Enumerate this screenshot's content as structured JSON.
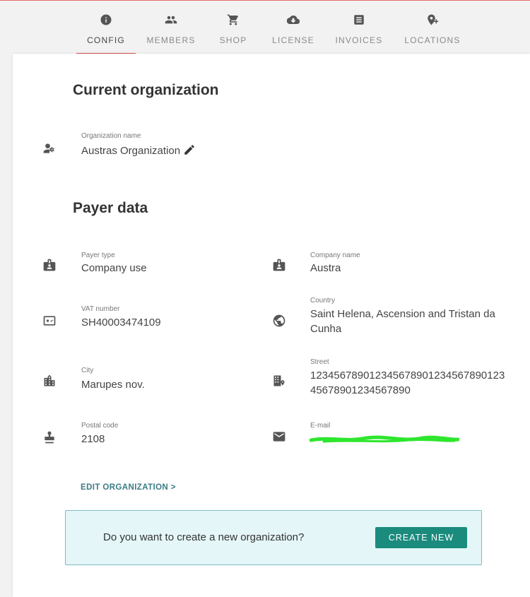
{
  "tabs": [
    {
      "label": "CONFIG",
      "icon": "info-icon"
    },
    {
      "label": "MEMBERS",
      "icon": "members-icon"
    },
    {
      "label": "SHOP",
      "icon": "cart-icon"
    },
    {
      "label": "LICENSE",
      "icon": "cloud-download-icon"
    },
    {
      "label": "INVOICES",
      "icon": "invoice-icon"
    },
    {
      "label": "LOCATIONS",
      "icon": "add-location-icon"
    }
  ],
  "active_tab": "CONFIG",
  "current_org": {
    "heading": "Current organization",
    "name_label": "Organization name",
    "name_value": "Austras Organization"
  },
  "payer": {
    "heading": "Payer data",
    "payer_type_label": "Payer type",
    "payer_type_value": "Company use",
    "company_name_label": "Company name",
    "company_name_value": "Austra",
    "vat_label": "VAT number",
    "vat_value": "SH40003474109",
    "country_label": "Country",
    "country_value_line1": "Saint Helena, Ascension and Tristan da",
    "country_value_line2": "Cunha",
    "city_label": "City",
    "city_value": "Marupes nov.",
    "street_label": "Street",
    "street_value_line1": "123456789012345678901234567890123",
    "street_value_line2": "45678901234567890",
    "postal_label": "Postal code",
    "postal_value": "2108",
    "email_label": "E-mail"
  },
  "edit_link": "EDIT ORGANIZATION  >",
  "callout": {
    "question": "Do you want to create a new organization?",
    "button": "CREATE NEW"
  },
  "colors": {
    "accent": "#d9534f",
    "button": "#1b8b7e",
    "callout_bg": "#e4f6f8",
    "redaction": "#2ee62e"
  }
}
